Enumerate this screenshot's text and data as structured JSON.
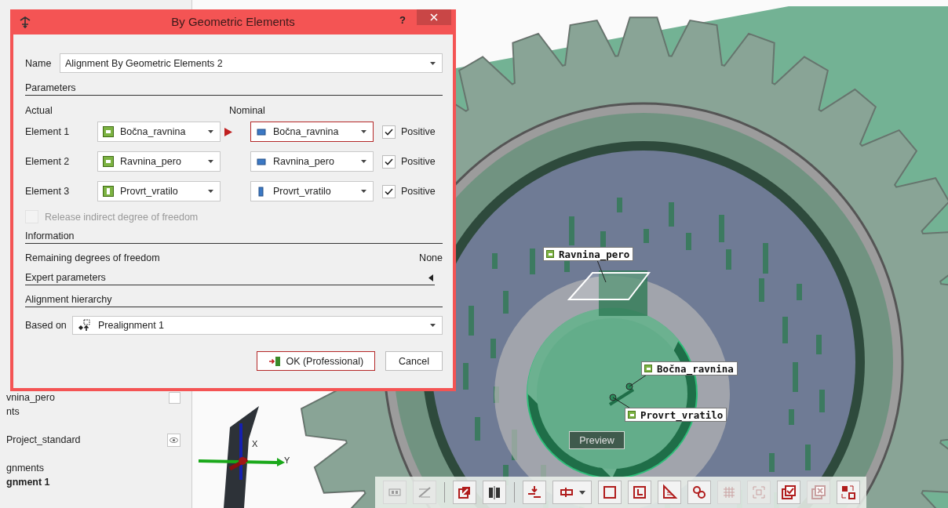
{
  "tree": {
    "groups": [
      [
        {
          "label": "vnina_pero",
          "bold": false,
          "kind": "checkbox",
          "checked": false
        },
        {
          "label": "nts",
          "bold": false,
          "kind": "plain"
        }
      ],
      [
        {
          "label": "Project_standard",
          "bold": false,
          "kind": "eye"
        }
      ],
      [
        {
          "label": "gnments",
          "bold": false,
          "kind": "plain"
        },
        {
          "label": "gnment 1",
          "bold": true,
          "kind": "plain"
        }
      ]
    ]
  },
  "viewport": {
    "labels": [
      {
        "text": "Ravnina_pero"
      },
      {
        "text": "Bočna_ravnina"
      },
      {
        "text": "Provrt_vratilo"
      }
    ],
    "axes": [
      "X",
      "Y"
    ],
    "preview": "Preview"
  },
  "toolbar": {
    "groups": [
      [
        {
          "disabled": true,
          "menu": false
        },
        {
          "disabled": true,
          "menu": false
        }
      ],
      [
        {
          "disabled": false,
          "menu": false
        },
        {
          "disabled": false,
          "menu": false
        }
      ],
      [
        {
          "disabled": false,
          "menu": false
        },
        {
          "disabled": false,
          "menu": true
        },
        {
          "disabled": false,
          "menu": false
        },
        {
          "disabled": false,
          "menu": false
        },
        {
          "disabled": false,
          "menu": false
        },
        {
          "disabled": false,
          "menu": false
        },
        {
          "disabled": true,
          "menu": false
        },
        {
          "disabled": true,
          "menu": false
        },
        {
          "disabled": false,
          "menu": false
        },
        {
          "disabled": true,
          "menu": false
        },
        {
          "disabled": false,
          "menu": false
        }
      ]
    ]
  },
  "dialog": {
    "title": "By Geometric Elements",
    "help": "?",
    "name_label": "Name",
    "name_value": "Alignment By Geometric Elements 2",
    "parameters": {
      "heading": "Parameters",
      "actual_heading": "Actual",
      "nominal_heading": "Nominal",
      "elements": [
        {
          "label": "Element 1",
          "actual": {
            "name": "Bočna_ravnina",
            "kind": "plane"
          },
          "nominal": {
            "name": "Bočna_ravnina",
            "kind": "plane"
          },
          "active": true,
          "positive_label": "Positive",
          "positive_checked": true
        },
        {
          "label": "Element 2",
          "actual": {
            "name": "Ravnina_pero",
            "kind": "plane"
          },
          "nominal": {
            "name": "Ravnina_pero",
            "kind": "plane"
          },
          "active": false,
          "positive_label": "Positive",
          "positive_checked": true
        },
        {
          "label": "Element 3",
          "actual": {
            "name": "Provrt_vratilo",
            "kind": "cylinder"
          },
          "nominal": {
            "name": "Provrt_vratilo",
            "kind": "cylinder"
          },
          "active": false,
          "positive_label": "Positive",
          "positive_checked": true
        }
      ],
      "release": {
        "label": "Release indirect degree of freedom",
        "checked": false,
        "disabled": true
      }
    },
    "information": {
      "heading": "Information",
      "remaining_label": "Remaining degrees of freedom",
      "remaining_value": "None"
    },
    "expert": {
      "heading": "Expert parameters",
      "expanded": false
    },
    "hierarchy": {
      "heading": "Alignment hierarchy",
      "based_on_label": "Based on",
      "based_on_value": "Prealignment 1"
    },
    "buttons": [
      {
        "label": "OK (Professional)",
        "kind": "default"
      },
      {
        "label": "Cancel",
        "kind": "normal"
      }
    ]
  }
}
